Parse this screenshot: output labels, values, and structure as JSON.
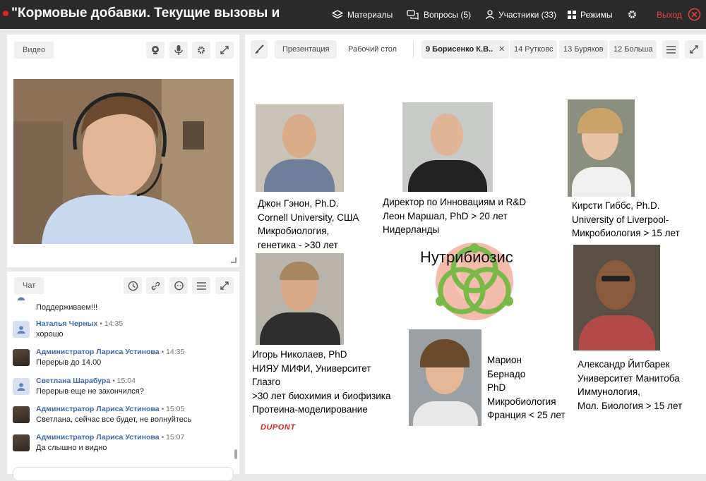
{
  "header": {
    "title": "\"Кормовые добавки. Текущие вызовы и",
    "nav": {
      "materials": "Материалы",
      "questions": "Вопросы (5)",
      "participants": "Участники (33)",
      "modes": "Режимы",
      "exit": "Выход"
    }
  },
  "video_panel": {
    "label": "Видео"
  },
  "chat_panel": {
    "label": "Чат",
    "messages": [
      {
        "author": "",
        "time": "",
        "text": "Поддерживаем!!!"
      },
      {
        "author": "Наталья Черных",
        "time": " • 14:35",
        "text": "хорошо"
      },
      {
        "author": "Администратор Лариса Устинова",
        "time": " • 14:35",
        "text": "Перерыв до 14.00"
      },
      {
        "author": "Светлана Шарабура",
        "time": " • 15:04",
        "text": "Перерыв еще не закончился?"
      },
      {
        "author": "Администратор Лариса Устинова",
        "time": " • 15:05",
        "text": "Светлана, сейчас все будет, не волнуйтесь"
      },
      {
        "author": "Администратор Лариса Устинова",
        "time": " • 15:07",
        "text": "Да слышно и видно"
      }
    ]
  },
  "main_panel": {
    "tabs": {
      "presentation": "Презентация",
      "desktop": "Рабочий стол",
      "active": "9 Борисенко К.В..",
      "tab14": "14 Рутковс",
      "tab13": "13 Буряков",
      "tab12": "12 Больша"
    }
  },
  "slide": {
    "logo_title": "Нутрибиозис",
    "dupont": "DUPONT",
    "people": [
      {
        "lines": [
          "Джон Гэнон, Ph.D.",
          "Cornell University, США",
          "Микробиология,",
          "генетика - >30 лет"
        ]
      },
      {
        "lines": [
          "Директор по Инновациям и R&D",
          "Леон Маршал, PhD > 20 лет",
          "Нидерланды"
        ]
      },
      {
        "lines": [
          "Кирсти Гиббс, Ph.D.",
          "University of Liverpool-",
          "Микробиология > 15 лет"
        ]
      },
      {
        "lines": [
          "Игорь Николаев, PhD",
          "НИЯУ МИФИ, Университет",
          "Глазго",
          ">30 лет биохимия и биофизика",
          "Протеина-моделирование"
        ]
      },
      {
        "lines": [
          "Марион",
          "Бернадо",
          "PhD",
          "Микробиология",
          "Франция < 25 лет"
        ]
      },
      {
        "lines": [
          "Александр Йитбарек",
          "Университет Манитоба",
          "Иммунология,",
          "Мол. Биология > 15 лет"
        ]
      }
    ]
  },
  "colors": {
    "topbar": "#2b2b2b",
    "exit": "#e84040",
    "author": "#3a6ab0",
    "logo_green": "#7bb84a",
    "logo_red": "#e8927a"
  }
}
